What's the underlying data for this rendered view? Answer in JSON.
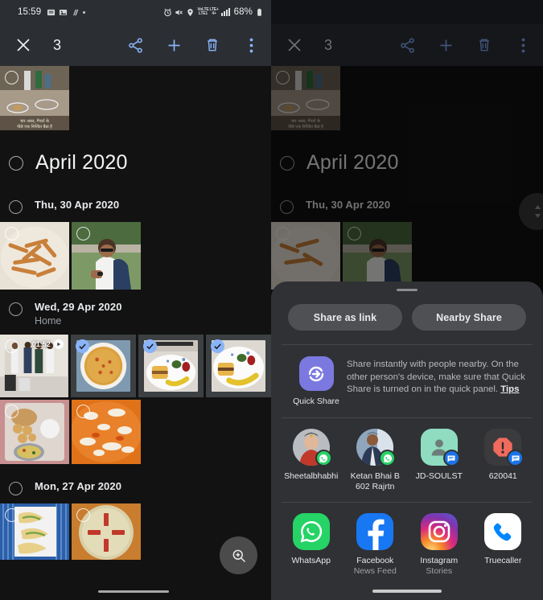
{
  "status_bar": {
    "time": "15:59",
    "battery": "68%",
    "network_label_top": "VoLTE",
    "network_label_bottom": "LTE1",
    "network_label_right_top": "LTE+",
    "network_label_right_bottom": "4+",
    "icons": [
      "message-icon",
      "image-icon",
      "mute-slash-icon",
      "dot-icon",
      "alarm-icon",
      "sound-off-icon",
      "location-icon",
      "signal-bars-icon",
      "battery-icon"
    ]
  },
  "action_bar": {
    "close_label": "close-icon",
    "selected_count": "3",
    "share_label": "share-icon",
    "add_label": "add-icon",
    "delete_label": "delete-icon",
    "more_label": "more-options-icon",
    "accent_color": "#8ab4f8"
  },
  "gallery": {
    "month_header": "April 2020",
    "groups": [
      {
        "date": "Thu, 30 Apr 2020",
        "place": ""
      },
      {
        "date": "Wed, 29 Apr 2020",
        "place": "Home"
      },
      {
        "date": "Mon, 27 Apr 2020",
        "place": ""
      }
    ],
    "video_duration": "01:52",
    "selected_thumbnails": 3,
    "fab_label": "zoom-in-icon"
  },
  "share_sheet": {
    "chips": [
      {
        "label": "Share as link"
      },
      {
        "label": "Nearby Share"
      }
    ],
    "quick_share": {
      "title": "Quick Share",
      "description": "Share instantly with people nearby. On the other person's device, make sure that Quick Share is turned on in the quick panel. ",
      "link": "Tips",
      "icon_color": "#7b79e0"
    },
    "contacts": [
      {
        "name": "Sheetalbhabhi",
        "badge": "whatsapp-icon",
        "avatar": "photo-woman"
      },
      {
        "name": "Ketan Bhai B 602 Rajrtn",
        "badge": "whatsapp-icon",
        "avatar": "photo-man"
      },
      {
        "name": "JD-SOULST",
        "badge": "messages-icon",
        "avatar": "default-person"
      },
      {
        "name": "620041",
        "badge": "messages-icon",
        "avatar": "spam-icon"
      }
    ],
    "apps": [
      {
        "name": "WhatsApp",
        "sub": "",
        "icon": "whatsapp-icon",
        "color": "#25D366"
      },
      {
        "name": "Facebook",
        "sub": "News Feed",
        "icon": "facebook-icon",
        "color": "#1877F2"
      },
      {
        "name": "Instagram",
        "sub": "Stories",
        "icon": "instagram-icon",
        "color": "#E1306C"
      },
      {
        "name": "Truecaller",
        "sub": "",
        "icon": "truecaller-icon",
        "color": "#0086FF"
      }
    ]
  }
}
